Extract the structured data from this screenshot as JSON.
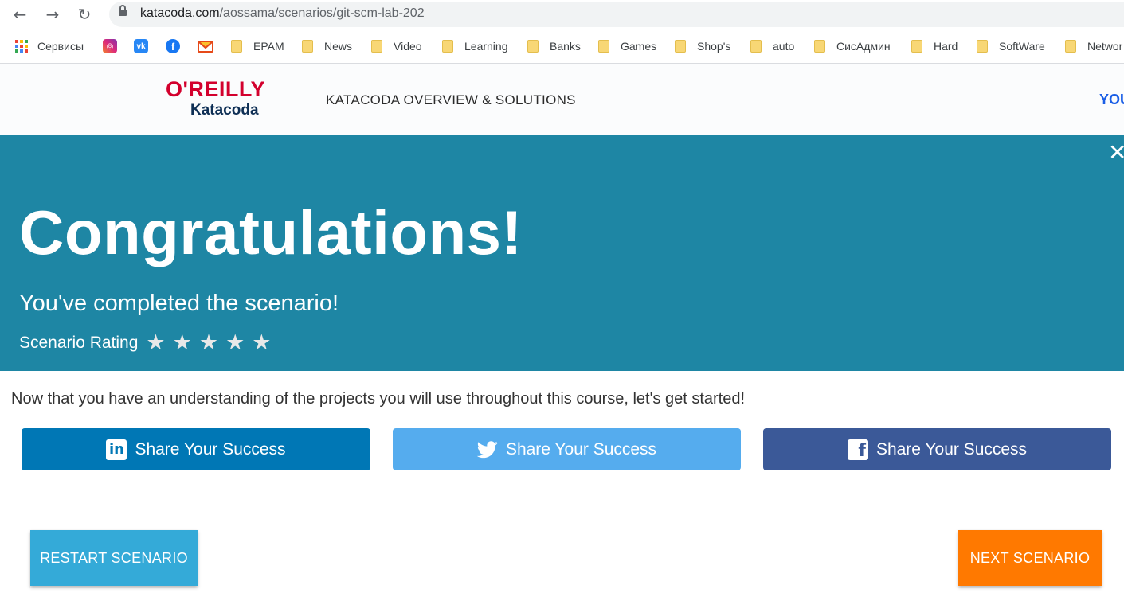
{
  "browser": {
    "url_domain": "katacoda.com",
    "url_path": "/aossama/scenarios/git-scm-lab-202",
    "back_icon": "←",
    "forward_icon": "→",
    "reload_icon": "↻"
  },
  "bookmarks": [
    {
      "label": "Сервисы",
      "icon": "apps-icon"
    },
    {
      "label": "",
      "icon": "instagram-icon"
    },
    {
      "label": "",
      "icon": "vk-icon"
    },
    {
      "label": "",
      "icon": "facebook-icon"
    },
    {
      "label": "",
      "icon": "mail-icon"
    },
    {
      "label": "EPAM",
      "icon": "folder-icon"
    },
    {
      "label": "News",
      "icon": "folder-icon"
    },
    {
      "label": "Video",
      "icon": "folder-icon"
    },
    {
      "label": "Learning",
      "icon": "folder-icon"
    },
    {
      "label": "Banks",
      "icon": "folder-icon"
    },
    {
      "label": "Games",
      "icon": "folder-icon"
    },
    {
      "label": "Shop's",
      "icon": "folder-icon"
    },
    {
      "label": "auto",
      "icon": "folder-icon"
    },
    {
      "label": "СисАдмин",
      "icon": "folder-icon"
    },
    {
      "label": "Hard",
      "icon": "folder-icon"
    },
    {
      "label": "SoftWare",
      "icon": "folder-icon"
    },
    {
      "label": "Networ",
      "icon": "folder-icon"
    }
  ],
  "header": {
    "logo_top": "O'REILLY",
    "logo_bottom": "Katacoda",
    "nav_title": "KATACODA OVERVIEW & SOLUTIONS",
    "nav_right": "YOU"
  },
  "banner": {
    "close_icon": "✕",
    "title": "Congratulations!",
    "subtitle": "You've completed the scenario!",
    "rating_label": "Scenario Rating",
    "rating_stars": 5,
    "rating_value": 0,
    "star_glyph": "★"
  },
  "content": {
    "intro": "Now that you have an understanding of the projects you will use throughout this course, let's get started!",
    "share_linkedin": "Share Your Success",
    "share_twitter": "Share Your Success",
    "share_facebook": "Share Your Success",
    "restart_label": "RESTART SCENARIO",
    "next_label": "NEXT SCENARIO"
  },
  "colors": {
    "banner": "#1e86a4",
    "linkedin": "#0077b5",
    "twitter": "#55acee",
    "facebook": "#3b5998",
    "restart": "#34aad8",
    "next": "#ff7900"
  }
}
